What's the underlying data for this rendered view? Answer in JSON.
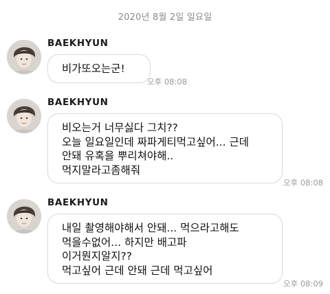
{
  "chat": {
    "date": "2020년 8월 2일 일요일",
    "messages": [
      {
        "sender": "BAEKHYUN",
        "lines": [
          "비가또오는군!"
        ],
        "time": "오후 08:08"
      },
      {
        "sender": "BAEKHYUN",
        "lines": [
          "비오는거 너무싫다 그치??",
          "오늘 일요일인데 짜파게티먹고싶어... 근데",
          "안돼 유혹을 뿌리쳐야해..",
          "먹지말라고좀해줘"
        ],
        "time": "오후 08:08"
      },
      {
        "sender": "BAEKHYUN",
        "lines": [
          "내일 촬영해야해서 안돼... 먹으라고해도",
          "먹을수없어... 하지만 배고파",
          "이거뭔지알지??",
          "먹고싶어 근데 안돼 근데 먹고싶어"
        ],
        "time": "오후 08:09"
      }
    ]
  },
  "icons": {
    "avatar": "profile-photo-avatar"
  }
}
